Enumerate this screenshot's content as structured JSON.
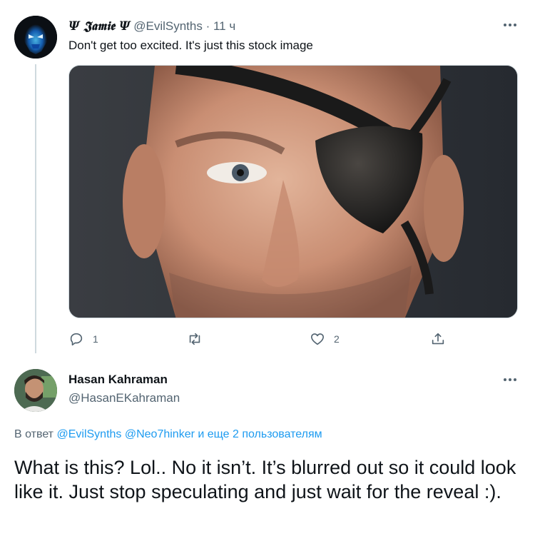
{
  "tweet1": {
    "display_name": "Ψ 𝕵𝖆𝖒𝖎𝖊 Ψ",
    "handle": "@EvilSynths",
    "separator": "·",
    "time": "11 ч",
    "text": "Don't get too excited. It's just this stock image",
    "actions": {
      "reply_count": "1",
      "like_count": "2"
    },
    "icons": {
      "reply": "reply-icon",
      "retweet": "retweet-icon",
      "like": "heart-icon",
      "share": "share-icon",
      "more": "more-icon"
    }
  },
  "tweet2": {
    "display_name": "Hasan Kahraman",
    "handle": "@HasanEKahraman",
    "reply_prefix": "В ответ",
    "reply_mention1": "@EvilSynths",
    "reply_mention2": "@Neo7hinker",
    "reply_suffix": "и еще 2 пользователям",
    "text": "What is this? Lol.. No it isn’t. It’s blurred out so it could look like it. Just stop speculating and just wait for the reveal :)."
  },
  "colors": {
    "link": "#1d9bf0",
    "secondary_text": "#536471",
    "primary_text": "#0f1419",
    "divider": "#cfd9de"
  }
}
